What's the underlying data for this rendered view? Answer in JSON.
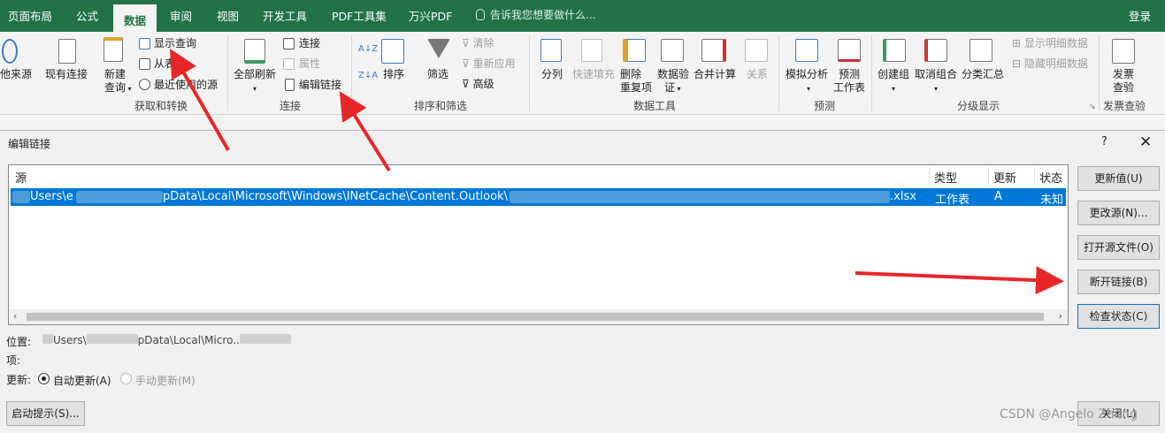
{
  "tabs": [
    "页面布局",
    "公式",
    "数据",
    "审阅",
    "视图",
    "开发工具",
    "PDF工具集",
    "万兴PDF"
  ],
  "tell_me": "告诉我您想要做什么...",
  "login": "登录",
  "ribbon": {
    "get": {
      "other_sources": "他来源",
      "existing": "现有连接",
      "new_query_1": "新建",
      "new_query_2": "查询",
      "show_queries": "显示查询",
      "from_table": "从表",
      "recent_sources": "最近使用的源",
      "group": "获取和转换"
    },
    "conn": {
      "refresh_all": "全部刷新",
      "connections": "连接",
      "properties": "属性",
      "edit_links": "编辑链接",
      "group": "连接"
    },
    "sort": {
      "sort": "排序",
      "filter": "筛选",
      "clear": "清除",
      "reapply": "重新应用",
      "advanced": "高级",
      "group": "排序和筛选"
    },
    "tools": {
      "split": "分列",
      "flash_fill": "快速填充",
      "remove_dup_1": "删除",
      "remove_dup_2": "重复项",
      "validation_1": "数据验",
      "validation_2": "证",
      "consolidate": "合并计算",
      "relations": "关系",
      "group": "数据工具"
    },
    "forecast": {
      "whatif": "模拟分析",
      "sheet_1": "预测",
      "sheet_2": "工作表",
      "group": "预测"
    },
    "outline": {
      "group_btn": "创建组",
      "ungroup": "取消组合",
      "subtotal": "分类汇总",
      "show_detail": "显示明细数据",
      "hide_detail": "隐藏明细数据",
      "group": "分级显示"
    },
    "invoice": {
      "check_1": "发票",
      "check_2": "查验",
      "group": "发票查验"
    }
  },
  "dialog": {
    "title": "编辑链接",
    "help": "?",
    "close": "✕",
    "columns": [
      "源",
      "类型",
      "更新",
      "状态"
    ],
    "row": {
      "source": "Users\\e",
      "mid": "pData\\Local\\Microsoft\\Windows\\INetCache\\Content.Outlook\\",
      "ext": ".xlsx",
      "type": "工作表",
      "update": "A",
      "status": "未知"
    },
    "buttons": [
      "更新值(U)",
      "更改源(N)...",
      "打开源文件(O)",
      "断开链接(B)",
      "检查状态(C)"
    ],
    "location_label": "位置:",
    "location_value": "Users\\",
    "location_value_2": "pData\\Local\\Micro..",
    "item_label": "项:",
    "update_label": "更新:",
    "auto_update": "自动更新(A)",
    "manual_update": "手动更新(M)",
    "startup_btn": "启动提示(S)...",
    "close_btn": "关闭(L)"
  },
  "watermark": "CSDN @Angelo Zhang",
  "colors": {
    "excel_green": "#217346",
    "selection": "#0078d7",
    "arrow": "#e8262a"
  }
}
